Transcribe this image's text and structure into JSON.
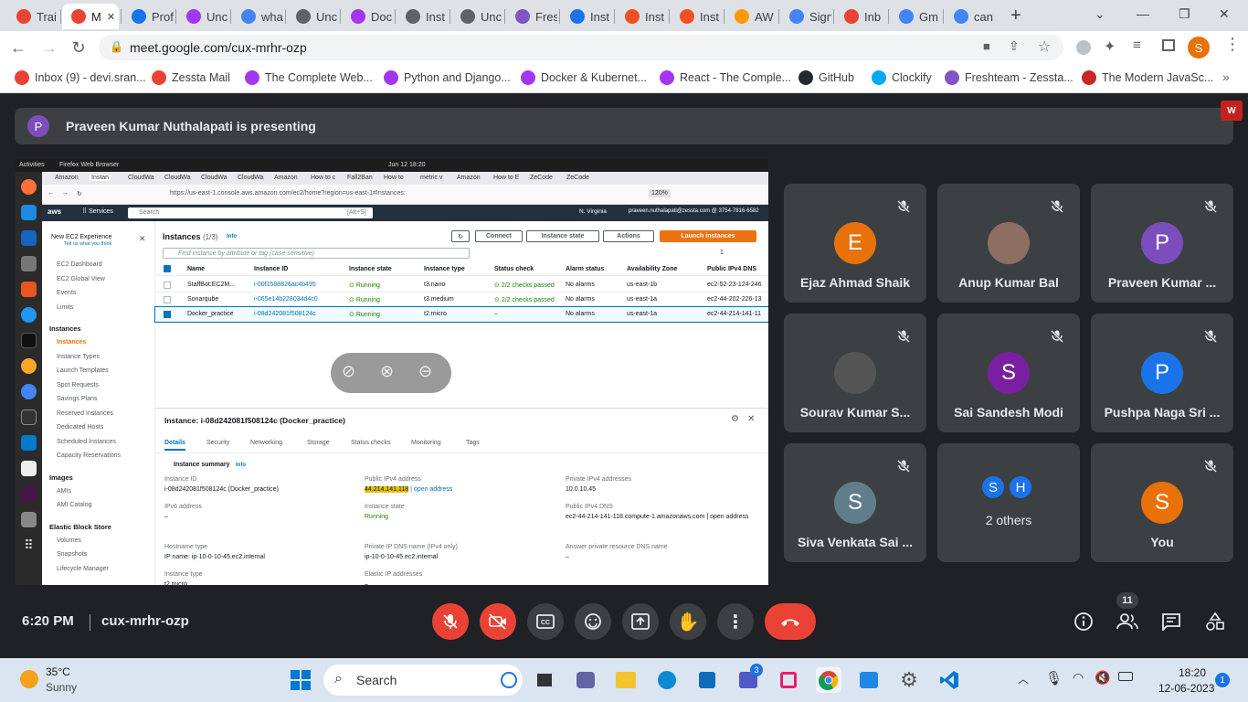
{
  "browser": {
    "tabs": [
      {
        "label": "Trai",
        "icon": "gmail-icon",
        "color": "#ea4335"
      },
      {
        "label": "M",
        "icon": "meet-recording-icon",
        "color": "#ea4335",
        "active": true
      },
      {
        "label": "Prof",
        "icon": "z-icon",
        "color": "#1a73e8"
      },
      {
        "label": "Unc",
        "icon": "udemy-icon",
        "color": "#a435f0"
      },
      {
        "label": "wha",
        "icon": "google-icon",
        "color": "#4285f4"
      },
      {
        "label": "Unc",
        "icon": "globe-icon",
        "color": "#5f6368"
      },
      {
        "label": "Doc",
        "icon": "udemy-icon",
        "color": "#a435f0"
      },
      {
        "label": "Inst",
        "icon": "globe-icon",
        "color": "#5f6368"
      },
      {
        "label": "Unc",
        "icon": "globe-icon",
        "color": "#5f6368"
      },
      {
        "label": "Fres",
        "icon": "freshteam-icon",
        "color": "#7e57c2"
      },
      {
        "label": "Inst",
        "icon": "edge-icon",
        "color": "#1a73e8"
      },
      {
        "label": "Inst",
        "icon": "windows-icon",
        "color": "#f25022"
      },
      {
        "label": "Inst",
        "icon": "windows-icon",
        "color": "#f25022"
      },
      {
        "label": "AW",
        "icon": "aws-icon",
        "color": "#ff9900"
      },
      {
        "label": "Sign",
        "icon": "google-icon",
        "color": "#4285f4"
      },
      {
        "label": "Inb",
        "icon": "gmail-icon",
        "color": "#ea4335"
      },
      {
        "label": "Gm",
        "icon": "google-icon",
        "color": "#4285f4"
      },
      {
        "label": "can",
        "icon": "google-icon",
        "color": "#4285f4"
      }
    ],
    "url": "meet.google.com/cux-mrhr-ozp",
    "profile_initial": "S",
    "bookmarks": [
      {
        "label": "Inbox (9) - devi.sran...",
        "icon": "gmail-icon",
        "color": "#ea4335"
      },
      {
        "label": "Zessta Mail",
        "icon": "gmail-icon",
        "color": "#ea4335"
      },
      {
        "label": "The Complete Web...",
        "icon": "udemy-icon",
        "color": "#a435f0"
      },
      {
        "label": "Python and Django...",
        "icon": "udemy-icon",
        "color": "#a435f0"
      },
      {
        "label": "Docker & Kubernet...",
        "icon": "udemy-icon",
        "color": "#a435f0"
      },
      {
        "label": "React - The Comple...",
        "icon": "udemy-icon",
        "color": "#a435f0"
      },
      {
        "label": "GitHub",
        "icon": "github-icon",
        "color": "#24292e"
      },
      {
        "label": "Clockify",
        "icon": "clockify-icon",
        "color": "#03a9f4"
      },
      {
        "label": "Freshteam - Zessta...",
        "icon": "freshteam-icon",
        "color": "#7e57c2"
      },
      {
        "label": "The Modern JavaSc...",
        "icon": "javascript-icon",
        "color": "#c62828"
      }
    ]
  },
  "meet": {
    "presenter_initial": "P",
    "presenting_text": "Praveen Kumar Nuthalapati is presenting",
    "time": "6:20 PM",
    "meeting_code": "cux-mrhr-ozp",
    "people_count": "11",
    "participants": [
      {
        "name": "Ejaz Ahmad Shaik",
        "initial": "E",
        "color": "#e8710a"
      },
      {
        "name": "Anup Kumar Bal",
        "initial": "",
        "color": "#8d6e63"
      },
      {
        "name": "Praveen Kumar ...",
        "initial": "P",
        "color": "#7c4dbc"
      },
      {
        "name": "Sourav Kumar S...",
        "initial": "",
        "color": "#555555"
      },
      {
        "name": "Sai Sandesh Modi",
        "initial": "S",
        "color": "#7b1fa2"
      },
      {
        "name": "Pushpa Naga Sri ...",
        "initial": "P",
        "color": "#1a73e8"
      },
      {
        "name": "Siva Venkata Sai ...",
        "initial": "S",
        "color": "#607d8b"
      },
      {
        "name": "2 others",
        "initial": "",
        "color": "#3c4043"
      },
      {
        "name": "You",
        "initial": "S",
        "color": "#e8710a"
      }
    ],
    "others_initials": [
      "S",
      "H"
    ]
  },
  "shared_screen": {
    "activities": "Activities",
    "app_name": "Firefox Web Browser",
    "datetime": "Jun 12  18:20",
    "ff_tabs": [
      "Amazon",
      "Instan",
      "CloudWa",
      "CloudWa",
      "CloudWa",
      "CloudWa",
      "Amazon",
      "How to c",
      "Fall2Ban",
      "How to",
      "metric v",
      "Amazon",
      "How to E",
      "ZeCode",
      "ZeCode"
    ],
    "ff_url": "https://us-east-1.console.aws.amazon.com/ec2/home?region=us-east-1#Instances:",
    "zoom": "120%",
    "aws": {
      "logo": "aws",
      "services": "Services",
      "search": "Search",
      "shortcut": "[Alt+S]",
      "region": "N. Virginia",
      "account": "praveen.nuthalapati@zessta.com @ 3754-7816-6582"
    },
    "sidebar": {
      "new_exp": "New EC2 Experience",
      "new_exp_sub": "Tell us what you think",
      "top_items": [
        "EC2 Dashboard",
        "EC2 Global View",
        "Events",
        "Limits"
      ],
      "sections": [
        {
          "title": "Instances",
          "items": [
            "Instances",
            "Instance Types",
            "Launch Templates",
            "Spot Requests",
            "Savings Plans",
            "Reserved Instances",
            "Dedicated Hosts",
            "Scheduled Instances",
            "Capacity Reservations"
          ]
        },
        {
          "title": "Images",
          "items": [
            "AMIs",
            "AMI Catalog"
          ]
        },
        {
          "title": "Elastic Block Store",
          "items": [
            "Volumes",
            "Snapshots",
            "Lifecycle Manager"
          ]
        }
      ]
    },
    "instances": {
      "title": "Instances",
      "count": "(1/3)",
      "info": "Info",
      "connect": "Connect",
      "instance_state": "Instance state",
      "actions": "Actions",
      "launch": "Launch instances",
      "filter_placeholder": "Find instance by attribute or tag (case-sensitive)",
      "page": "1",
      "columns": [
        "Name",
        "Instance ID",
        "Instance state",
        "Instance type",
        "Status check",
        "Alarm status",
        "Availability Zone",
        "Public IPv4 DNS"
      ],
      "rows": [
        {
          "name": "StaffBot:EC2M...",
          "id": "i-00f1588826ac4b495",
          "state": "Running",
          "type": "t3.nano",
          "status": "2/2 checks passed",
          "alarm": "No alarms",
          "az": "us-east-1b",
          "dns": "ec2-52-23-124-246",
          "checked": false
        },
        {
          "name": "Sonarqube",
          "id": "i-065e14b228034d4c0",
          "state": "Running",
          "type": "t3.medium",
          "status": "2/2 checks passed",
          "alarm": "No alarms",
          "az": "us-east-1a",
          "dns": "ec2-44-202-226-13",
          "checked": false
        },
        {
          "name": "Docker_practice",
          "id": "i-08d242081f508124c",
          "state": "Running",
          "type": "t2.micro",
          "status": "–",
          "alarm": "No alarms",
          "az": "us-east-1a",
          "dns": "ec2-44-214-141-11",
          "checked": true
        }
      ]
    },
    "detail": {
      "title": "Instance: i-08d242081f508124c (Docker_practice)",
      "tabs": [
        "Details",
        "Security",
        "Networking",
        "Storage",
        "Status checks",
        "Monitoring",
        "Tags"
      ],
      "summary": "Instance summary",
      "info": "Info",
      "fields": [
        {
          "label": "Instance ID",
          "value": "i-08d242081f508124c (Docker_practice)"
        },
        {
          "label": "Public IPv4 address",
          "value": "44.214.141.118",
          "extra": "| open address"
        },
        {
          "label": "Private IPv4 addresses",
          "value": "10.0.10.45"
        },
        {
          "label": "IPv6 address",
          "value": "–"
        },
        {
          "label": "Instance state",
          "value": "Running"
        },
        {
          "label": "Public IPv4 DNS",
          "value": "ec2-44-214-141-118.compute-1.amazonaws.com | open address"
        },
        {
          "label": "Hostname type",
          "value": "IP name: ip-10-0-10-45.ec2.internal"
        },
        {
          "label": "Private IP DNS name (IPv4 only)",
          "value": "ip-10-0-10-45.ec2.internal"
        },
        {
          "label": "Answer private resource DNS name",
          "value": "–"
        },
        {
          "label": "Instance type",
          "value": "t2.micro"
        },
        {
          "label": "Elastic IP addresses",
          "value": "–"
        }
      ]
    }
  },
  "taskbar": {
    "weather_temp": "35°C",
    "weather_desc": "Sunny",
    "search": "Search",
    "time": "18:20",
    "date": "12-06-2023",
    "notif": "1",
    "teams_badge": "3"
  }
}
